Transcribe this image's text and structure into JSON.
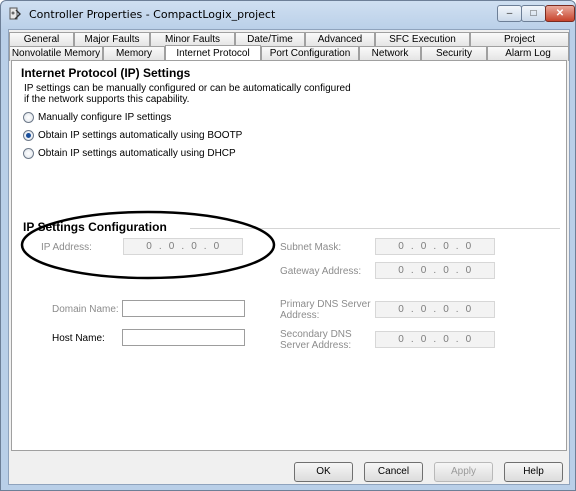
{
  "window": {
    "title": "Controller Properties - CompactLogix_project",
    "min_label": "–",
    "max_label": "□",
    "close_label": "✕"
  },
  "tabs": {
    "row1": [
      "General",
      "Major Faults",
      "Minor Faults",
      "Date/Time",
      "Advanced",
      "SFC Execution",
      "Project"
    ],
    "row2": [
      "Nonvolatile Memory",
      "Memory",
      "Internet Protocol",
      "Port Configuration",
      "Network",
      "Security",
      "Alarm Log"
    ],
    "active": "Internet Protocol"
  },
  "ip_settings": {
    "title": "Internet Protocol (IP) Settings",
    "description_line1": "IP settings can be manually configured or can be automatically configured",
    "description_line2": "if the network supports this capability.",
    "options": [
      {
        "label": "Manually configure IP settings",
        "checked": false
      },
      {
        "label": "Obtain IP settings automatically using BOOTP",
        "checked": true
      },
      {
        "label": "Obtain IP settings automatically using DHCP",
        "checked": false
      }
    ]
  },
  "config": {
    "title": "IP Settings Configuration",
    "ip_address_label": "IP Address:",
    "ip_address_value": "0  .  0  .  0  .  0",
    "subnet_mask_label": "Subnet Mask:",
    "subnet_mask_value": "0  .  0  .  0  .  0",
    "gateway_label": "Gateway Address:",
    "gateway_value": "0  .  0  .  0  .  0",
    "domain_name_label": "Domain Name:",
    "domain_name_value": "",
    "host_name_label": "Host Name:",
    "host_name_value": "",
    "primary_dns_label_1": "Primary DNS Server",
    "primary_dns_label_2": "Address:",
    "primary_dns_value": "0  .  0  .  0  .  0",
    "secondary_dns_label_1": "Secondary DNS",
    "secondary_dns_label_2": "Server Address:",
    "secondary_dns_value": "0  .  0  .  0  .  0"
  },
  "buttons": {
    "ok": "OK",
    "cancel": "Cancel",
    "apply": "Apply",
    "help": "Help"
  },
  "colors": {
    "annotation_ellipse": "#000000",
    "selected_radio": "#1a4f9c"
  },
  "icons": {
    "app_icon": "controller-properties-icon"
  }
}
